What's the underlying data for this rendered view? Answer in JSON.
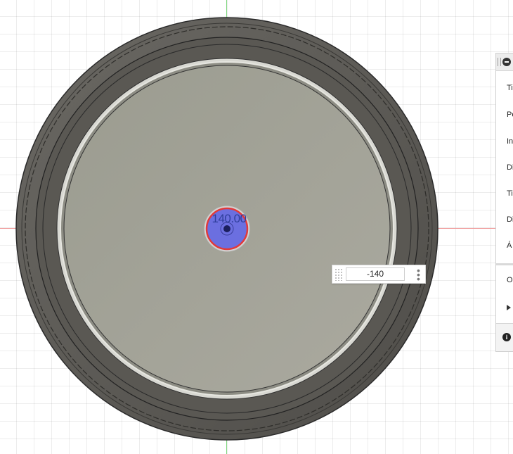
{
  "canvas": {
    "dimension_label": "140.00",
    "dimension_input": {
      "value": "-140"
    }
  },
  "panel": {
    "rows": [
      {
        "label": "Ti"
      },
      {
        "label": "Pe"
      },
      {
        "label": "In"
      },
      {
        "label": "Di"
      },
      {
        "label": "Ti"
      },
      {
        "label": "Di"
      },
      {
        "label": "Á"
      },
      {
        "label": "O"
      }
    ],
    "icons": {
      "collapse": "minus-circle-icon",
      "expand": "caret-right-icon",
      "info": "info-icon"
    }
  },
  "colors": {
    "outer_rim": "#5f5d59",
    "inner_face": "#a3a398",
    "selection_fill": "#6b6fe0",
    "selection_ring": "#e23a3a",
    "x_axis": "#f09a9a",
    "y_axis": "#7ed67e"
  }
}
